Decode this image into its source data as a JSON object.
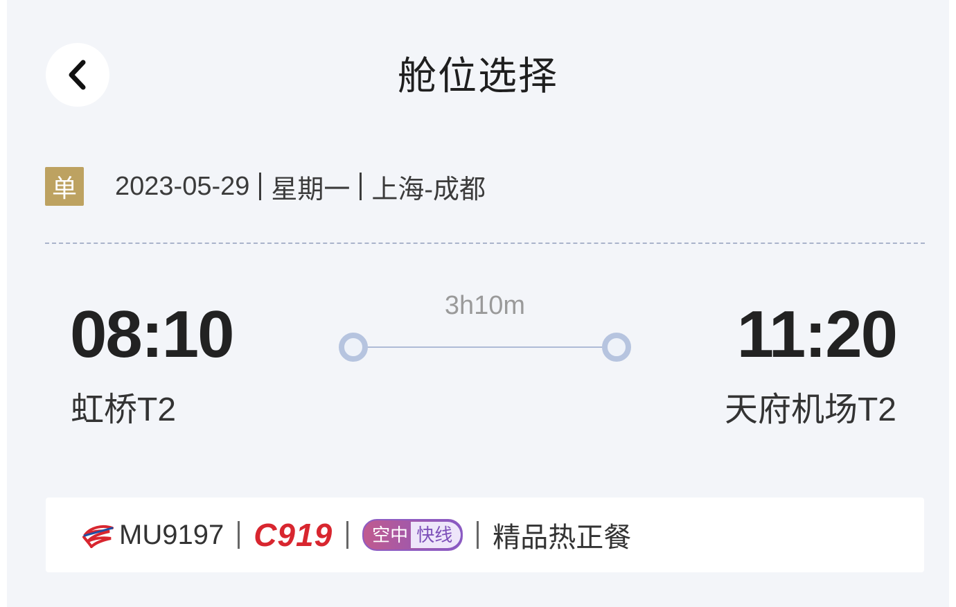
{
  "header": {
    "title": "舱位选择",
    "back_icon": "chevron-left-icon"
  },
  "trip": {
    "type_badge": "单",
    "date": "2023-05-29",
    "weekday": "星期一",
    "route": "上海-成都"
  },
  "flight": {
    "departure_time": "08:10",
    "departure_airport": "虹桥T2",
    "arrival_time": "11:20",
    "arrival_airport": "天府机场T2",
    "duration": "3h10m"
  },
  "flight_card": {
    "airline_icon": "china-eastern-logo-icon",
    "flight_number": "MU9197",
    "aircraft": "C919",
    "badge_left": "空中",
    "badge_right": "快线",
    "meal": "精品热正餐"
  },
  "colors": {
    "background": "#f3f5f9",
    "badge_gold": "#bda261",
    "aircraft_red": "#d8262f",
    "route_line": "#aebbd6",
    "express_purple": "#8458c4"
  }
}
